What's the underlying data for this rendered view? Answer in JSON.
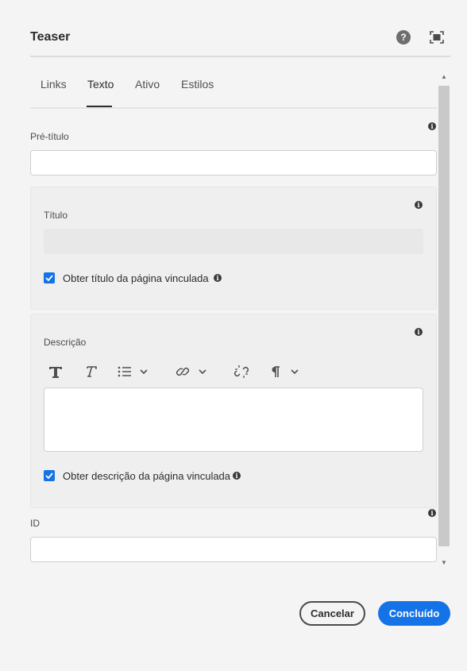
{
  "dialog": {
    "title": "Teaser"
  },
  "tabs": [
    {
      "label": "Links"
    },
    {
      "label": "Texto"
    },
    {
      "label": "Ativo"
    },
    {
      "label": "Estilos"
    }
  ],
  "fields": {
    "pretitle": {
      "label": "Pré-título",
      "value": ""
    },
    "title": {
      "label": "Título",
      "value": "",
      "checkbox_label": "Obter título da página vinculada",
      "checked": true
    },
    "description": {
      "label": "Descrição",
      "value": "",
      "checkbox_label": "Obter descrição da página vinculada",
      "checked": true
    },
    "id": {
      "label": "ID",
      "value": ""
    }
  },
  "rte_toolbar": [
    "bold-icon",
    "italic-icon",
    "list-icon",
    "link-icon",
    "unlink-icon",
    "paragraph-icon"
  ],
  "buttons": {
    "cancel": "Cancelar",
    "done": "Concluído"
  },
  "colors": {
    "accent": "#1473e6",
    "background": "#f4f4f4"
  }
}
